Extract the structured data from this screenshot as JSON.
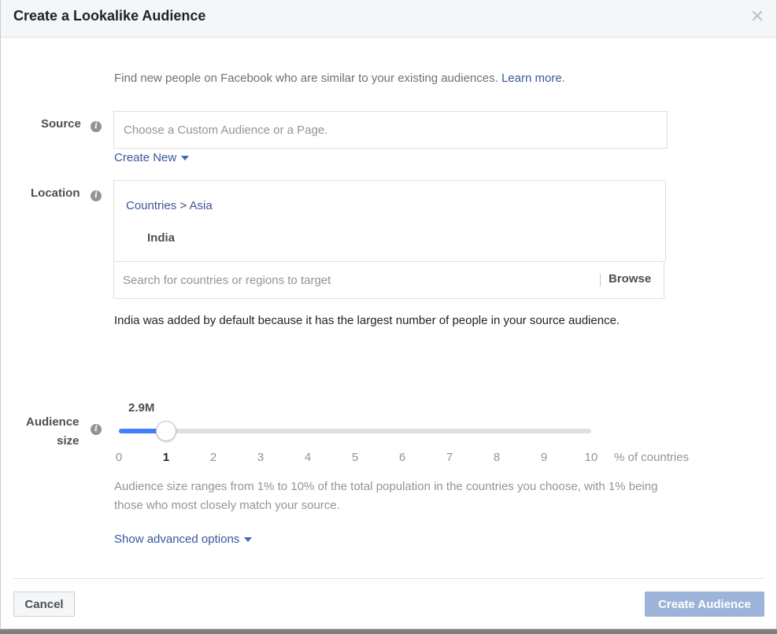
{
  "dialog": {
    "title": "Create a Lookalike Audience",
    "close_icon": "close-icon"
  },
  "intro": {
    "text": "Find new people on Facebook who are similar to your existing audiences.",
    "link": "Learn more",
    "suffix": "."
  },
  "source": {
    "label": "Source",
    "placeholder": "Choose a Custom Audience or a Page.",
    "value": "",
    "create_new": "Create New"
  },
  "location": {
    "label": "Location",
    "breadcrumb_root": "Countries",
    "breadcrumb_sep": ">",
    "breadcrumb_region": "Asia",
    "selected_country": "India",
    "search_placeholder": "Search for countries or regions to target",
    "browse_label": "Browse",
    "default_note": "India was added by default because it has the largest number of people in your source audience."
  },
  "audience_size": {
    "label_line1": "Audience",
    "label_line2": "size",
    "estimated_reach": "2.9M",
    "selected_percent": 1,
    "min_percent": 0,
    "max_percent": 10,
    "ticks": [
      "0",
      "1",
      "2",
      "3",
      "4",
      "5",
      "6",
      "7",
      "8",
      "9",
      "10"
    ],
    "unit_label": "% of countries",
    "range_note": "Audience size ranges from 1% to 10% of the total population in the countries you choose, with 1% being those who most closely match your source."
  },
  "advanced": {
    "label": "Show advanced options"
  },
  "footer": {
    "cancel_label": "Cancel",
    "create_label": "Create Audience"
  },
  "colors": {
    "link": "#365899",
    "slider_fill": "#4080ff",
    "primary_disabled": "#9cb4d8"
  }
}
